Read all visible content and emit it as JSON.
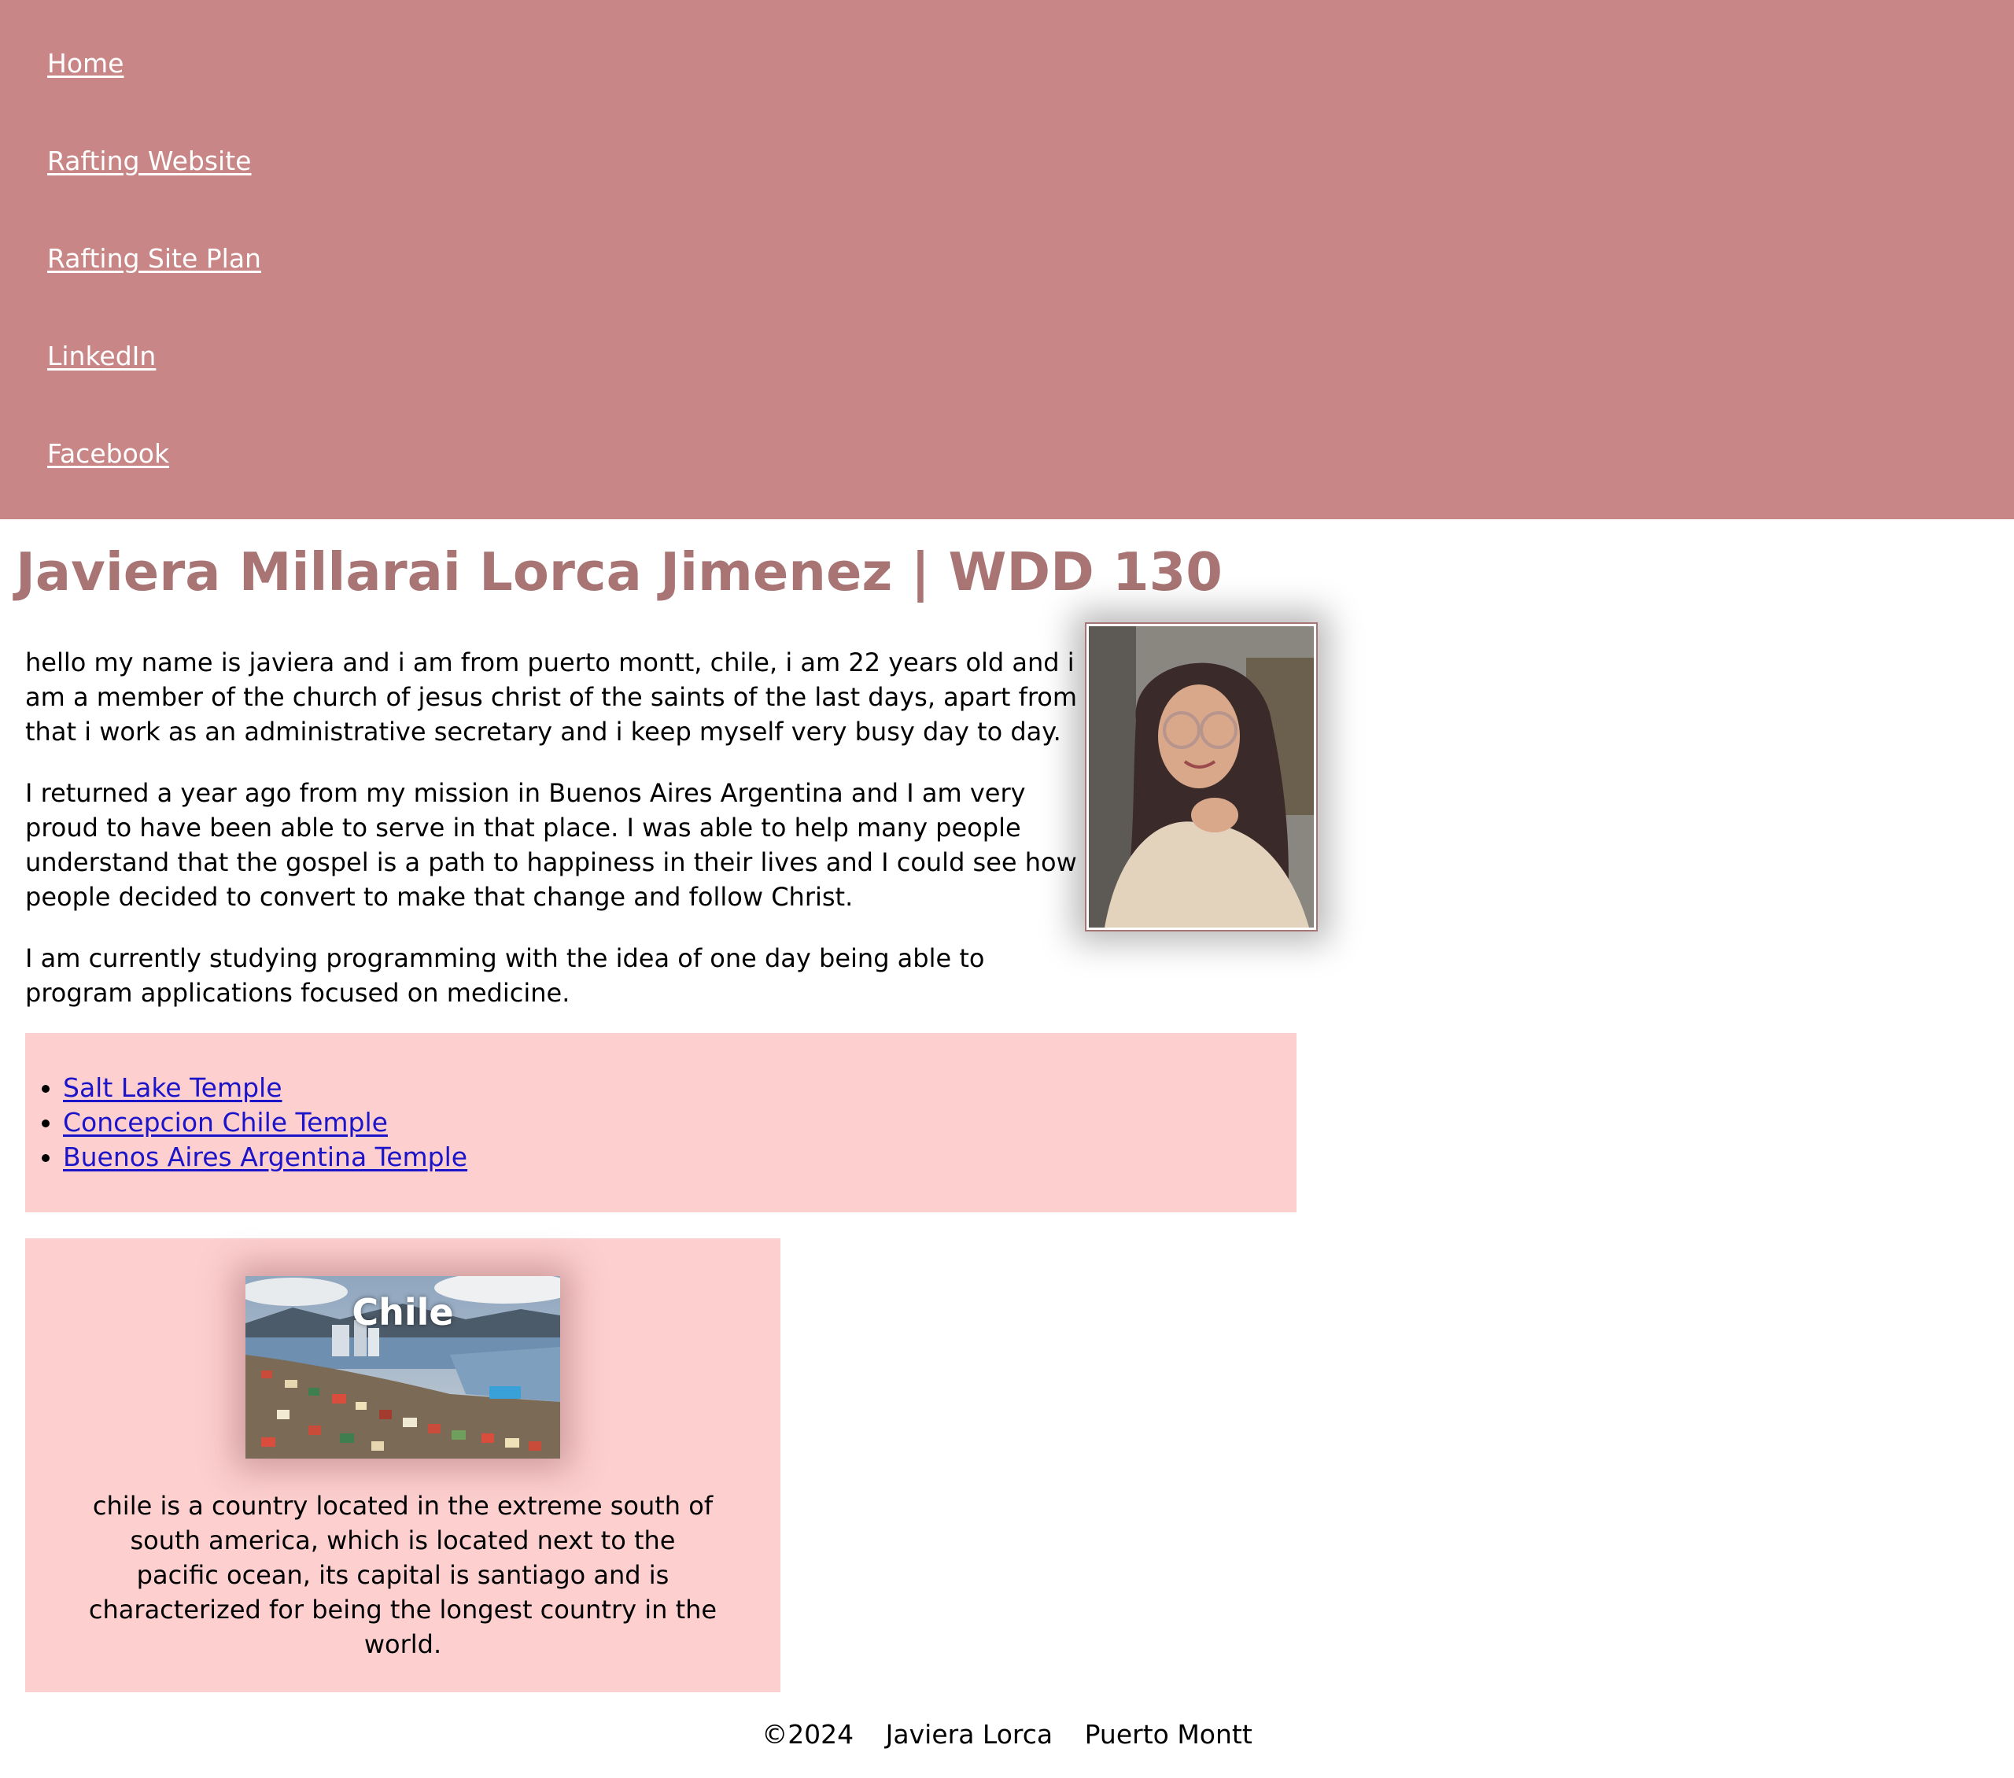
{
  "nav": {
    "items": [
      {
        "label": "Home"
      },
      {
        "label": "Rafting Website"
      },
      {
        "label": "Rafting Site Plan"
      },
      {
        "label": "LinkedIn"
      },
      {
        "label": "Facebook"
      }
    ]
  },
  "header": {
    "title": "Javiera Millarai Lorca Jimenez | WDD 130"
  },
  "intro": {
    "paragraphs": [
      "hello my name is javiera and i am from puerto montt, chile, i am 22 years old and i am a member of the church of jesus christ of the saints of the last days, apart from that i work as an administrative secretary and i keep myself very busy day to day.",
      "I returned a year ago from my mission in Buenos Aires Argentina and I am very proud to have been able to serve in that place. I was able to help many people understand that the gospel is a path to happiness in their lives and I could see how people decided to convert to make that change and follow Christ.",
      "I am currently studying programming with the idea of one day being able to program applications focused on medicine."
    ]
  },
  "temples": {
    "links": [
      {
        "label": "Salt Lake Temple"
      },
      {
        "label": "Concepcion Chile Temple"
      },
      {
        "label": "Buenos Aires Argentina Temple"
      }
    ]
  },
  "chile": {
    "title": "Chile",
    "description": "chile is a country located in the extreme south of south america, which is located next to the pacific ocean, its capital is santiago and is characterized for being the longest country in the world."
  },
  "footer": {
    "copyright": "©2024",
    "name": "Javiera Lorca",
    "place": "Puerto Montt"
  },
  "colors": {
    "nav_background": "#c98687",
    "title_color": "#a87474",
    "panel_background": "#fdcfcf",
    "link_color": "#1c14c9"
  }
}
